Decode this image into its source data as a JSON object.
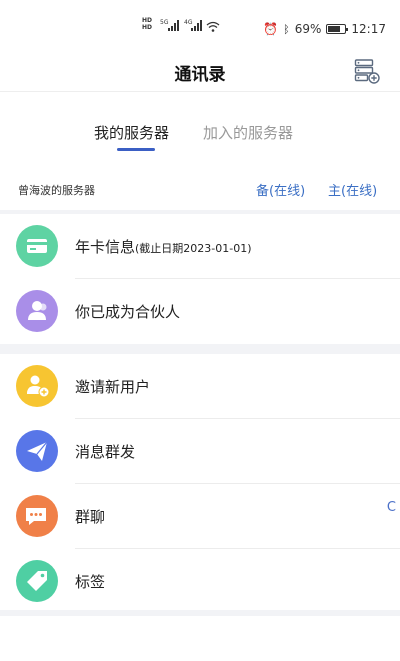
{
  "status_bar": {
    "network_left": "HD",
    "network_right": "HD",
    "label_5g": "5G",
    "label_4g": "4G",
    "battery": "69%",
    "time": "12:17"
  },
  "header": {
    "title": "通讯录",
    "add_icon": "server-add-icon"
  },
  "tabs": [
    {
      "label": "我的服务器",
      "active": true
    },
    {
      "label": "加入的服务器",
      "active": false
    }
  ],
  "server": {
    "name": "曾海波的服务器",
    "backup_label": "备(在线)",
    "main_label": "主(在线)"
  },
  "items": [
    {
      "label": "年卡信息",
      "sub": "(截止日期2023-01-01)",
      "icon": "card-icon",
      "color": "#5ed3a3"
    },
    {
      "label": "你已成为合伙人",
      "icon": "partner-icon",
      "color": "#a98ee8"
    },
    {
      "label": "邀请新用户",
      "icon": "add-user-icon",
      "color": "#f7c531"
    },
    {
      "label": "消息群发",
      "icon": "send-icon",
      "color": "#5876e8"
    },
    {
      "label": "群聊",
      "icon": "chat-icon",
      "color": "#f08048"
    },
    {
      "label": "标签",
      "icon": "tag-icon",
      "color": "#4fcfa3"
    }
  ],
  "edge_letter": "C",
  "colors": {
    "accent": "#3b5fc4",
    "link": "#3b6fc4"
  }
}
